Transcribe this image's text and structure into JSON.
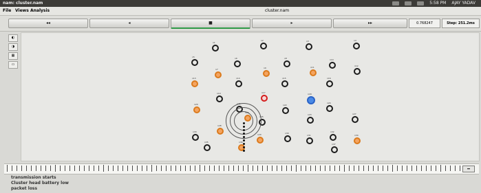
{
  "window": {
    "title": "nam: cluster.nam",
    "status_time": "5:58 PM",
    "status_user": "AJAY YADAV"
  },
  "menu": {
    "items": [
      "File",
      "Views",
      "Analysis"
    ],
    "file_name": "cluster.nam"
  },
  "controls": {
    "rewind": "◂◂",
    "back": "◂",
    "stop": "■",
    "play": "▸",
    "fastforward": "▸▸",
    "time_value": "0.768247",
    "step_value": "Step: 251.2ms"
  },
  "canvas_labels": {
    "center_label": "",
    "red_label": "",
    "blue_label": ""
  },
  "nodes": [
    {
      "type": "black",
      "label": "n1"
    },
    {
      "type": "black",
      "label": "n2"
    },
    {
      "type": "black",
      "label": "n3"
    },
    {
      "type": "black",
      "label": "n4"
    },
    {
      "type": "black",
      "label": "n5"
    },
    {
      "type": "black",
      "label": "n6"
    },
    {
      "type": "orange",
      "label": "n7"
    },
    {
      "type": "black",
      "label": "n8"
    },
    {
      "type": "orange",
      "label": "n9"
    },
    {
      "type": "black",
      "label": "n10"
    },
    {
      "type": "orange",
      "label": "n11"
    },
    {
      "type": "black",
      "label": "n12"
    },
    {
      "type": "orange",
      "label": "n13"
    },
    {
      "type": "black",
      "label": "n14"
    },
    {
      "type": "black",
      "label": "n15"
    },
    {
      "type": "black",
      "label": "n16"
    },
    {
      "type": "red",
      "label": "n17"
    },
    {
      "type": "blue",
      "label": "n18"
    },
    {
      "type": "black",
      "label": "n19"
    },
    {
      "type": "orange",
      "label": "n20"
    },
    {
      "type": "black",
      "label": "n21"
    },
    {
      "type": "black",
      "label": "n22"
    },
    {
      "type": "black",
      "label": "n23"
    },
    {
      "type": "black",
      "label": "n24"
    },
    {
      "type": "orange",
      "label": "n25"
    },
    {
      "type": "black",
      "label": "n26"
    },
    {
      "type": "black",
      "label": "n27"
    },
    {
      "type": "orange",
      "label": "n28"
    },
    {
      "type": "orange",
      "label": "n29"
    },
    {
      "type": "black",
      "label": "n30"
    },
    {
      "type": "black",
      "label": "n31"
    },
    {
      "type": "black",
      "label": "n32"
    },
    {
      "type": "black",
      "label": "n33"
    },
    {
      "type": "orange",
      "label": "n34"
    },
    {
      "type": "black",
      "label": "n35"
    },
    {
      "type": "orange",
      "label": "n36"
    },
    {
      "type": "black",
      "label": "n37"
    }
  ],
  "logs": {
    "line1": "transmission starts",
    "line2": "Cluster head battery low",
    "line3": "packet loss"
  }
}
